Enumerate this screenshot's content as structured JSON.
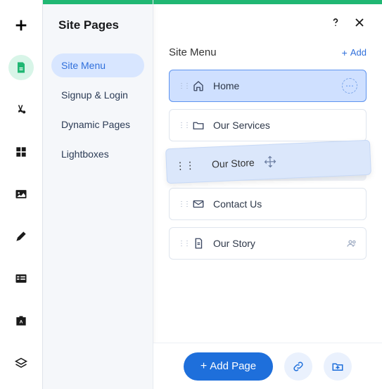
{
  "header": {
    "title": "Site Pages"
  },
  "nav": {
    "items": [
      {
        "label": "Site Menu"
      },
      {
        "label": "Signup & Login"
      },
      {
        "label": "Dynamic Pages"
      },
      {
        "label": "Lightboxes"
      }
    ]
  },
  "section": {
    "title": "Site Menu",
    "add_label": "Add"
  },
  "pages": [
    {
      "label": "Home"
    },
    {
      "label": "Our Services"
    },
    {
      "label": "Our Store"
    },
    {
      "label": "Contact Us"
    },
    {
      "label": "Our Story"
    }
  ],
  "footer": {
    "add_page_label": "Add Page"
  }
}
